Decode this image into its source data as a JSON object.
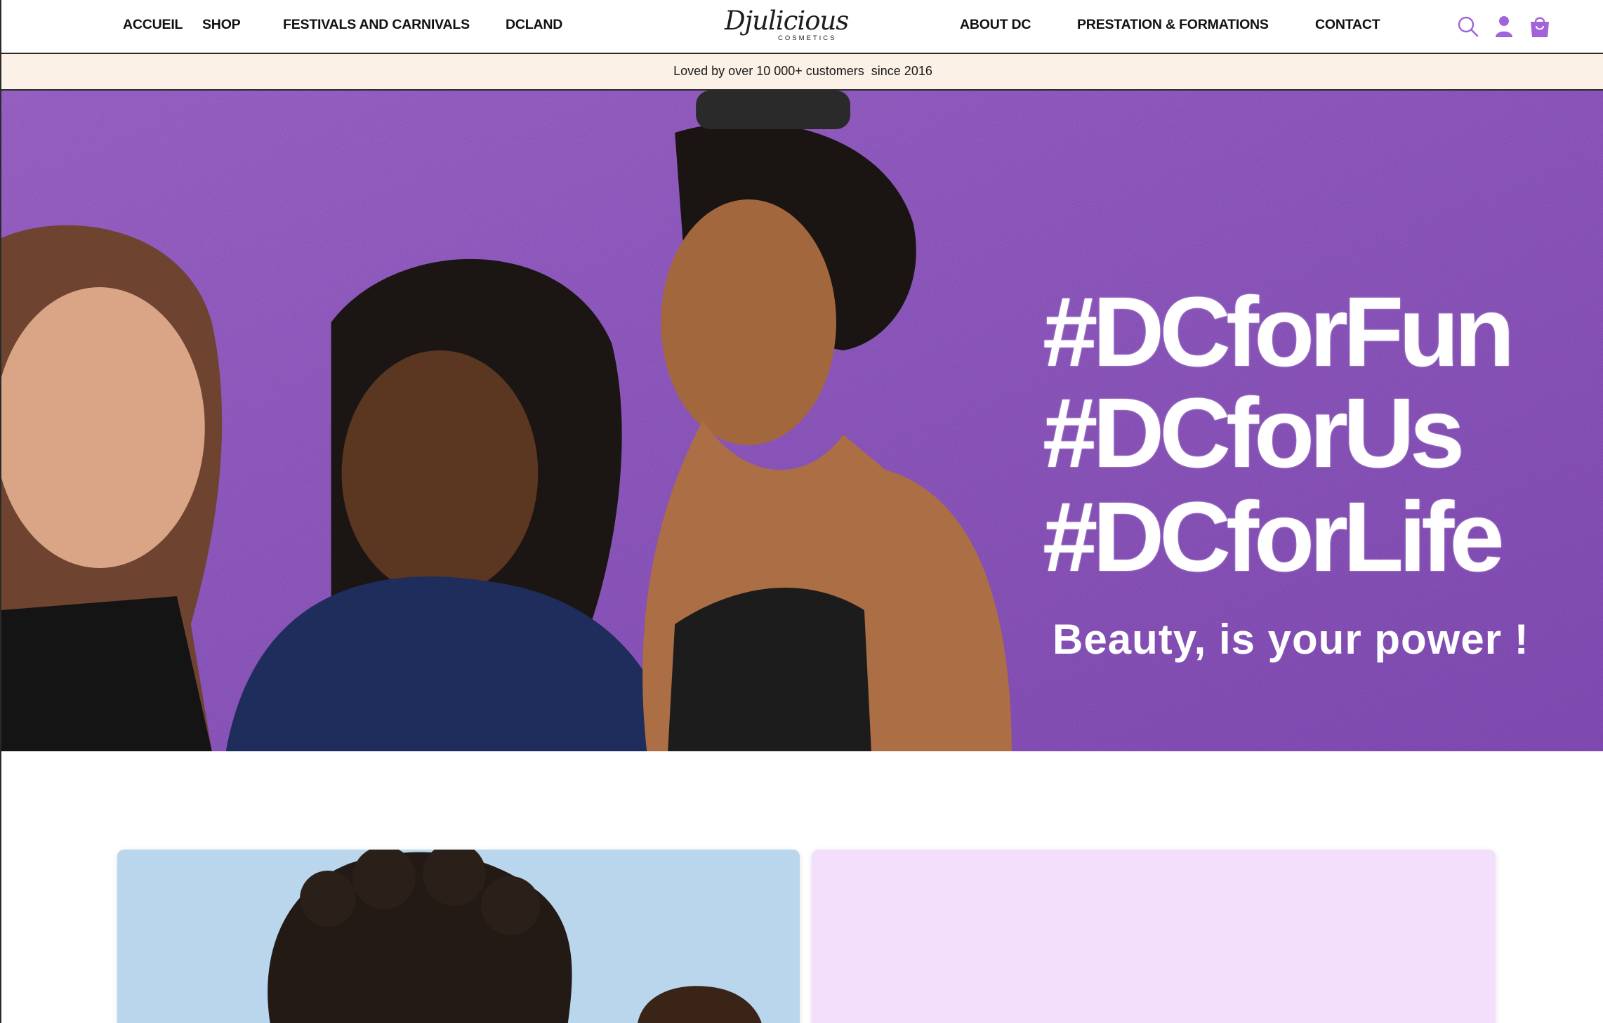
{
  "header": {
    "nav_left": [
      {
        "label": "ACCUEIL"
      },
      {
        "label": "SHOP"
      },
      {
        "label": "FESTIVALS AND CARNIVALS"
      },
      {
        "label": "DCLAND"
      }
    ],
    "logo": {
      "script": "Djulicious",
      "sub": "COSMETICS"
    },
    "nav_right": [
      {
        "label": "ABOUT DC"
      },
      {
        "label": "PRESTATION & FORMATIONS"
      },
      {
        "label": "CONTACT"
      }
    ],
    "icons": [
      "search-icon",
      "account-icon",
      "cart-icon"
    ],
    "icon_color": "#a064d8"
  },
  "announcement": {
    "text": "Loved by over 10 000+ customers  since 2016",
    "background": "#fcf1e6"
  },
  "hero": {
    "hashtags": [
      "#DCforFun",
      "#DCforUs",
      "#DCforLife"
    ],
    "tagline": "Beauty, is your power !",
    "background_color": "#9b5ed1"
  },
  "cards": {
    "photo_card_color": "#b9d6ec",
    "promo_card_color": "#f3dffc"
  }
}
